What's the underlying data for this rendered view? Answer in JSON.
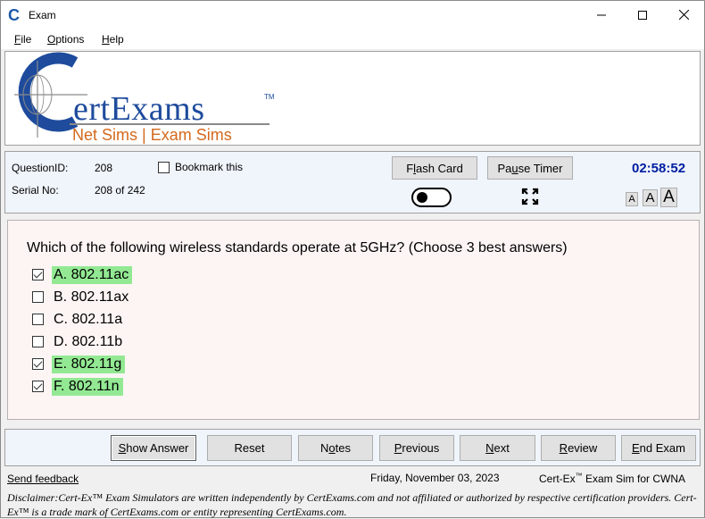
{
  "window": {
    "title": "Exam",
    "app_icon_glyph": "C",
    "controls": {
      "minimize": "minimize-icon",
      "maximize": "maximize-icon",
      "close": "close-icon"
    }
  },
  "menu": {
    "items": [
      {
        "label": "File",
        "accel": "F",
        "rest": "ile"
      },
      {
        "label": "Options",
        "accel": "O",
        "rest": "ptions"
      },
      {
        "label": "Help",
        "accel": "H",
        "rest": "elp"
      }
    ]
  },
  "banner": {
    "logo_c": "C",
    "logo_name": "ertExams",
    "trademark": "TM",
    "tagline": "Net Sims | Exam Sims",
    "colors": {
      "logo_blue": "#1e4b9c",
      "tagline_orange": "#d4691c"
    }
  },
  "info": {
    "question_id_label": "QuestionID:",
    "question_id": "208",
    "serial_label": "Serial No:",
    "serial": "208 of 242",
    "bookmark_label": "Bookmark this",
    "bookmark_checked": false,
    "flash_card": {
      "label": "Flash Card",
      "accel_pre": "F",
      "accel": "l",
      "rest": "ash Card"
    },
    "pause_timer": {
      "label": "Pause Timer",
      "pre": "Pa",
      "accel": "u",
      "rest": "se Timer"
    },
    "timer": "02:58:52",
    "timer_color": "#001ea0",
    "font_sizes": [
      "A",
      "A",
      "A"
    ],
    "fullscreen_icon": "expand-icon"
  },
  "question": {
    "text": "Which of the following wireless standards operate at 5GHz? (Choose 3 best answers)",
    "options": [
      {
        "label": "A. 802.11ac",
        "checked": true,
        "correct": true
      },
      {
        "label": "B. 802.11ax",
        "checked": false,
        "correct": false
      },
      {
        "label": "C. 802.11a",
        "checked": false,
        "correct": false
      },
      {
        "label": "D. 802.11b",
        "checked": false,
        "correct": false
      },
      {
        "label": "E. 802.11g",
        "checked": true,
        "correct": true
      },
      {
        "label": "F. 802.11n",
        "checked": true,
        "correct": true
      }
    ],
    "highlight_color": "#93e993"
  },
  "nav": {
    "show_answer": {
      "label": "Show Answer",
      "accel": "S",
      "rest": "how Answer"
    },
    "reset": {
      "label": "Reset"
    },
    "notes": {
      "label": "Notes",
      "pre": "N",
      "accel": "o",
      "rest": "tes"
    },
    "previous": {
      "label": "Previous",
      "accel": "P",
      "rest": "revious"
    },
    "next": {
      "label": "Next",
      "accel": "N",
      "rest": "ext"
    },
    "review": {
      "label": "Review",
      "accel": "R",
      "rest": "eview"
    },
    "end_exam": {
      "label": "End Exam",
      "accel": "E",
      "rest": "nd Exam"
    }
  },
  "footer": {
    "feedback": "Send feedback",
    "date": "Friday, November 03, 2023",
    "product_pre": "Cert-Ex",
    "product_tm": "™",
    "product_post": " Exam Sim for CWNA",
    "disclaimer": "Disclaimer:Cert-Ex™ Exam Simulators are written independently by CertExams.com and not affiliated or authorized by respective certification providers. Cert-Ex™ is a trade mark of CertExams.com or entity representing CertExams.com."
  }
}
